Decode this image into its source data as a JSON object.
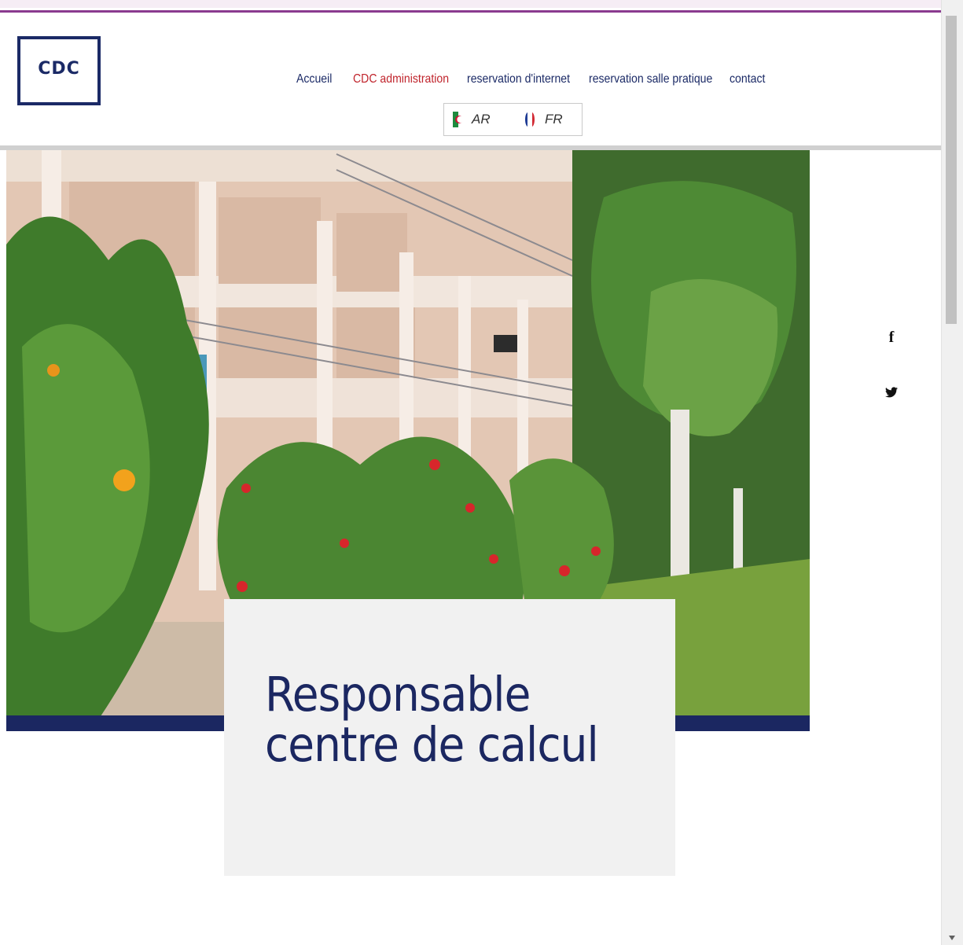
{
  "header": {
    "logo_text": "CDC",
    "nav": [
      {
        "label": "Accueil",
        "active": false
      },
      {
        "label": "CDC administration",
        "active": true
      },
      {
        "label": "reservation d'internet",
        "active": false
      },
      {
        "label": "reservation salle pratique",
        "active": false
      },
      {
        "label": "contact",
        "active": false
      }
    ],
    "languages": [
      {
        "code": "AR",
        "icon": "algeria-flag-icon"
      },
      {
        "code": "FR",
        "icon": "france-flag-icon"
      }
    ]
  },
  "hero": {
    "image_label": "building-photo",
    "card_title": "Responsable centre de calcul"
  },
  "social": [
    {
      "icon": "facebook-icon",
      "glyph": "f"
    },
    {
      "icon": "twitter-icon",
      "glyph": ""
    }
  ],
  "colors": {
    "brand_navy": "#1b2761",
    "active_red": "#c0242c",
    "accent_purple": "#8a3b8f",
    "card_bg": "#f1f1f1"
  }
}
